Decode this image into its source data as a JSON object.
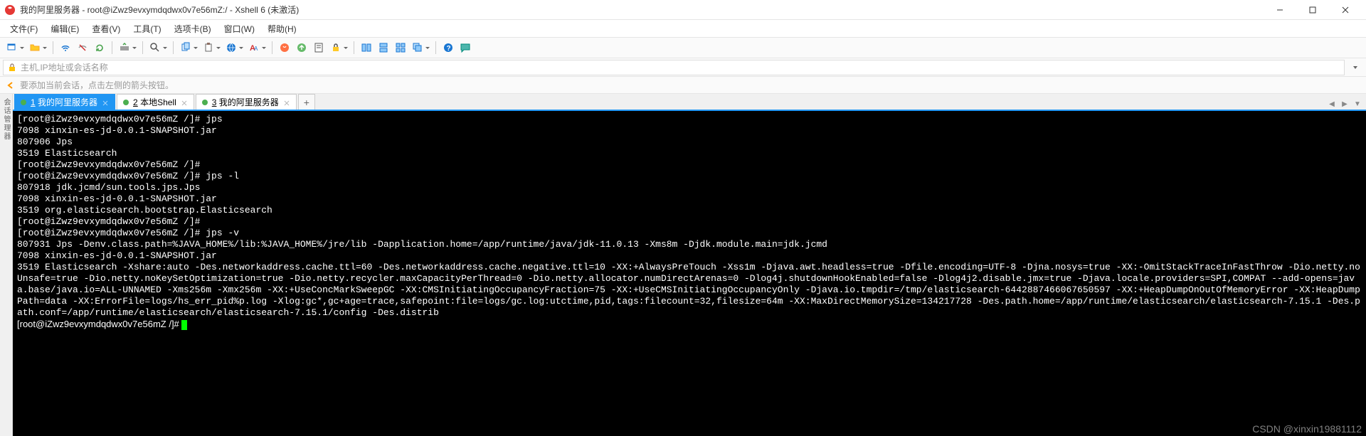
{
  "title": "我的阿里服务器 - root@iZwz9evxymdqdwx0v7e56mZ:/ - Xshell 6 (未激活)",
  "menu": {
    "file": "文件(F)",
    "edit": "编辑(E)",
    "view": "查看(V)",
    "tools": "工具(T)",
    "tab": "选项卡(B)",
    "window": "窗口(W)",
    "help": "帮助(H)"
  },
  "addressbar": {
    "placeholder": "主机,IP地址或会话名称"
  },
  "tipbar": {
    "text": "要添加当前会话，点击左侧的箭头按钮。"
  },
  "sidetool_label": "会话管理器",
  "tabs": [
    {
      "num": "1",
      "label": "我的阿里服务器",
      "active": true
    },
    {
      "num": "2",
      "label": "本地Shell",
      "active": false
    },
    {
      "num": "3",
      "label": "我的阿里服务器",
      "active": false
    }
  ],
  "addtab": "+",
  "terminal_lines": [
    "[root@iZwz9evxymdqdwx0v7e56mZ /]# jps",
    "7098 xinxin-es-jd-0.0.1-SNAPSHOT.jar",
    "807906 Jps",
    "3519 Elasticsearch",
    "[root@iZwz9evxymdqdwx0v7e56mZ /]# ",
    "[root@iZwz9evxymdqdwx0v7e56mZ /]# jps -l",
    "807918 jdk.jcmd/sun.tools.jps.Jps",
    "7098 xinxin-es-jd-0.0.1-SNAPSHOT.jar",
    "3519 org.elasticsearch.bootstrap.Elasticsearch",
    "[root@iZwz9evxymdqdwx0v7e56mZ /]# ",
    "[root@iZwz9evxymdqdwx0v7e56mZ /]# jps -v",
    "807931 Jps -Denv.class.path=%JAVA_HOME%/lib:%JAVA_HOME%/jre/lib -Dapplication.home=/app/runtime/java/jdk-11.0.13 -Xms8m -Djdk.module.main=jdk.jcmd",
    "7098 xinxin-es-jd-0.0.1-SNAPSHOT.jar",
    "3519 Elasticsearch -Xshare:auto -Des.networkaddress.cache.ttl=60 -Des.networkaddress.cache.negative.ttl=10 -XX:+AlwaysPreTouch -Xss1m -Djava.awt.headless=true -Dfile.encoding=UTF-8 -Djna.nosys=true -XX:-OmitStackTraceInFastThrow -Dio.netty.noUnsafe=true -Dio.netty.noKeySetOptimization=true -Dio.netty.recycler.maxCapacityPerThread=0 -Dio.netty.allocator.numDirectArenas=0 -Dlog4j.shutdownHookEnabled=false -Dlog4j2.disable.jmx=true -Djava.locale.providers=SPI,COMPAT --add-opens=java.base/java.io=ALL-UNNAMED -Xms256m -Xmx256m -XX:+UseConcMarkSweepGC -XX:CMSInitiatingOccupancyFraction=75 -XX:+UseCMSInitiatingOccupancyOnly -Djava.io.tmpdir=/tmp/elasticsearch-6442887466067650597 -XX:+HeapDumpOnOutOfMemoryError -XX:HeapDumpPath=data -XX:ErrorFile=logs/hs_err_pid%p.log -Xlog:gc*,gc+age=trace,safepoint:file=logs/gc.log:utctime,pid,tags:filecount=32,filesize=64m -XX:MaxDirectMemorySize=134217728 -Des.path.home=/app/runtime/elasticsearch/elasticsearch-7.15.1 -Des.path.conf=/app/runtime/elasticsearch/elasticsearch-7.15.1/config -Des.distrib",
    "[root@iZwz9evxymdqdwx0v7e56mZ /]# "
  ],
  "watermark": "CSDN @xinxin19881112"
}
